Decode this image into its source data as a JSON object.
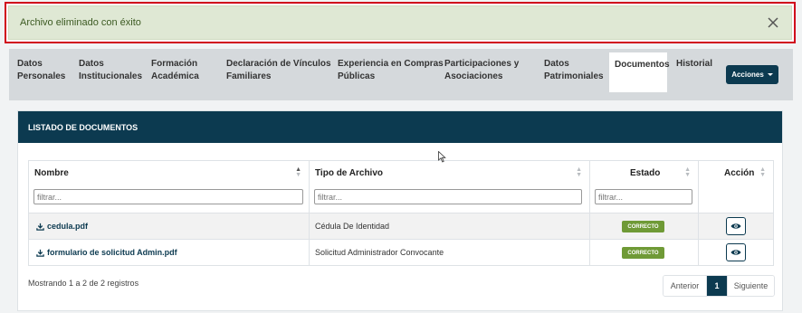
{
  "alert": {
    "message": "Archivo eliminado con éxito"
  },
  "tabs": [
    {
      "line1": "Datos",
      "line2": "Personales"
    },
    {
      "line1": "Datos",
      "line2": "Institucionales"
    },
    {
      "line1": "Formación",
      "line2": "Académica"
    },
    {
      "line1": "Declaración de Vínculos",
      "line2": "Familiares"
    },
    {
      "line1": "Experiencia en Compras",
      "line2": "Públicas"
    },
    {
      "line1": "Participaciones y",
      "line2": "Asociaciones"
    },
    {
      "line1": "Datos",
      "line2": "Patrimoniales"
    },
    {
      "line1": "Documentos",
      "line2": ""
    },
    {
      "line1": "Historial",
      "line2": ""
    }
  ],
  "active_tab": "Documentos",
  "actions_label": "Acciones",
  "card": {
    "title": "LISTADO DE DOCUMENTOS"
  },
  "table": {
    "columns": [
      "Nombre",
      "Tipo de Archivo",
      "Estado",
      "Acción"
    ],
    "filter_placeholder": "filtrar...",
    "rows": [
      {
        "nombre": "cedula.pdf",
        "tipo": "Cédula De Identidad",
        "estado": "CORRECTO"
      },
      {
        "nombre": "formulario de solicitud Admin.pdf",
        "tipo": "Solicitud Administrador Convocante",
        "estado": "CORRECTO"
      }
    ]
  },
  "info_text": "Mostrando 1 a 2 de 2 registros",
  "pagination": {
    "prev": "Anterior",
    "current": "1",
    "next": "Siguiente"
  },
  "colors": {
    "primary": "#0c3a50",
    "success": "#6f9a36",
    "alert_bg": "#dfe8d4",
    "alert_border": "#d0021b"
  }
}
